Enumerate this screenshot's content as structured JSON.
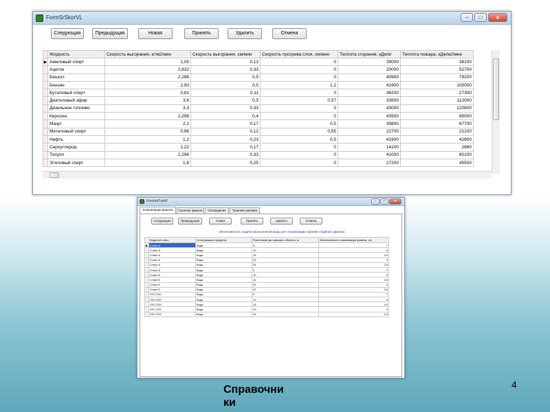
{
  "window1": {
    "title": "FormSrSkorVL",
    "controls": {
      "minimize": "–",
      "maximize": "□",
      "close": "x"
    },
    "toolbar": {
      "next": "Следующая",
      "prev": "Предыдущая",
      "new": "Новая",
      "accept": "Принять",
      "delete": "Удалить",
      "cancel": "Отмена"
    },
    "columns": [
      "Жидкость",
      "Скорость выгорания, кг/м2/мин",
      "Скорость выгорания, см/мин",
      "Скорость прогрева слоя, см/мин",
      "Теплота сгорания, кДж/кг",
      "Теплота пожара, кДж/м2/мин"
    ],
    "rows": [
      [
        "Амиловый спирт",
        "1,05",
        "0,13",
        "0",
        "39000",
        "38100"
      ],
      [
        "Ацетон",
        "2,832",
        "0,33",
        "0",
        "20000",
        "52700"
      ],
      [
        "Бензол",
        "2,298",
        "0,5",
        "0",
        "40900",
        "79200"
      ],
      [
        "Бензин",
        "2,93",
        "0,5",
        "1,2",
        "41900",
        "105000"
      ],
      [
        "Бутиловый спирт",
        "0,81",
        "0,11",
        "0",
        "36200",
        "27300"
      ],
      [
        "Диэтиловый эфир",
        "3,6",
        "0,5",
        "0,57",
        "33500",
        "112000"
      ],
      [
        "Дизельное топливо",
        "3,3",
        "0,33",
        "0",
        "43000",
        "120600"
      ],
      [
        "Керосин",
        "2,298",
        "0,4",
        "0",
        "43500",
        "85000"
      ],
      [
        "Мазут",
        "2,1",
        "0,17",
        "0,5",
        "39800",
        "67700"
      ],
      [
        "Метиловый спирт",
        "0,96",
        "0,12",
        "0,55",
        "22700",
        "21200"
      ],
      [
        "Нефть",
        "1,2",
        "0,23",
        "0,5",
        "41900",
        "42800"
      ],
      [
        "Сероуглерод",
        "2,22",
        "0,17",
        "0",
        "14100",
        "2680"
      ],
      [
        "Толуол",
        "2,298",
        "0,33",
        "0",
        "41000",
        "80100"
      ],
      [
        "Этиловый спирт",
        "1,8",
        "0,25",
        "0",
        "27200",
        "45500"
      ]
    ]
  },
  "window2": {
    "title": "FormIntTushF",
    "tabs": [
      "Локализация факела",
      "Тушение факела",
      "Охлаждение",
      "Тушение разлива"
    ],
    "toolbar": {
      "next": "Следующая",
      "prev": "Предыдущая",
      "new": "Новая",
      "accept": "Принять",
      "delete": "Удалить",
      "cancel": "Отмена"
    },
    "subtitle": "Интенсивность подачи распыленной воды для локализации горения струйного факела",
    "columns": [
      "Водяной ствол",
      "Огнетушащее средство",
      "Расстояние до горящего объекта, м",
      "Интенсивность локализации факела, л/с"
    ],
    "rows": [
      [
        "Ствол А",
        "Вода",
        "5",
        "7"
      ],
      [
        "Ствол А",
        "Вода",
        "10",
        "5"
      ],
      [
        "Ствол А",
        "Вода",
        "15",
        "3,5"
      ],
      [
        "Ствол А",
        "Вода",
        "20",
        "3"
      ],
      [
        "Ствол А",
        "Вода",
        "25",
        "2,5"
      ],
      [
        "Ствол Б",
        "Вода",
        "5",
        "7"
      ],
      [
        "Ствол Б",
        "Вода",
        "10",
        "5"
      ],
      [
        "Ствол Б",
        "Вода",
        "15",
        "3,5"
      ],
      [
        "Ствол Б",
        "Вода",
        "20",
        "3"
      ],
      [
        "Ствол Б",
        "Вода",
        "25",
        "2,5"
      ],
      [
        "ЛУС-П20",
        "Вода",
        "5",
        "7"
      ],
      [
        "ЛУС-П20",
        "Вода",
        "10",
        "5"
      ],
      [
        "ЛУС-П20",
        "Вода",
        "15",
        "3,5"
      ],
      [
        "ЛУС-П20",
        "Вода",
        "20",
        "3"
      ],
      [
        "ЛУС-П20",
        "Вода",
        "25",
        "2,5"
      ]
    ]
  },
  "caption_line1": "Справочни",
  "caption_line2": "ки",
  "page_number": "4",
  "row_indicator": "▶"
}
